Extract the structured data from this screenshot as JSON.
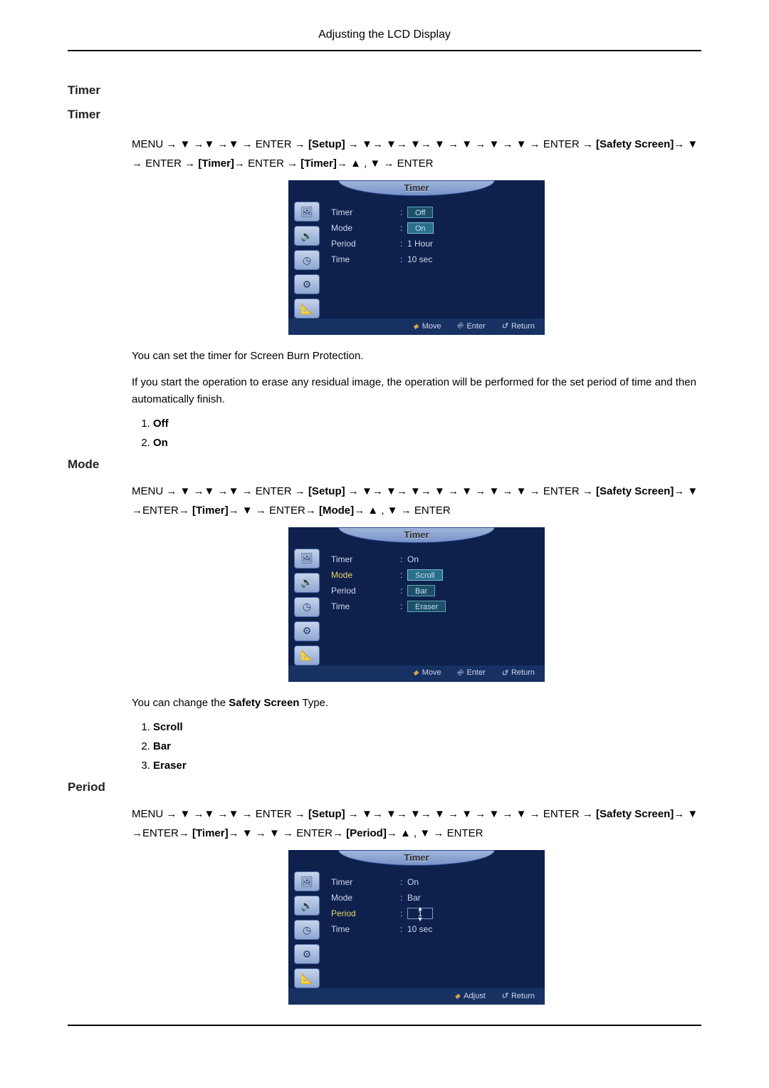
{
  "page_header": "Adjusting the LCD Display",
  "sections": {
    "timer": {
      "heading1": "Timer",
      "heading2": "Timer",
      "nav": {
        "start": "MENU → ",
        "enter1": " → ENTER → ",
        "setup": "[Setup]",
        "mid": " → ",
        "enter2": " → ENTER →",
        "safety": "[Safety Screen]",
        "safety_after": "→ ",
        "enter3": " → ENTER → ",
        "timer1": "[Timer]",
        "enter4": "→ ENTER → ",
        "timer2": "[Timer]",
        "tail": "→ ",
        "enter_final": " → ENTER"
      },
      "desc1": "You can set the timer for Screen Burn Protection.",
      "desc2": "If you start the operation to erase any residual image, the operation will be performed for the set period of time and then automatically finish.",
      "options": [
        "Off",
        "On"
      ],
      "osd": {
        "title": "Timer",
        "rows": [
          {
            "label": "Timer",
            "value_off": "Off",
            "value_on": "On"
          },
          {
            "label": "Mode",
            "value": ""
          },
          {
            "label": "Period",
            "value": "1 Hour"
          },
          {
            "label": "Time",
            "value": "10 sec"
          }
        ],
        "footer": {
          "move": "Move",
          "enter": "Enter",
          "return": "Return"
        }
      }
    },
    "mode": {
      "heading": "Mode",
      "nav": {
        "start": "MENU → ",
        "enter1": " → ENTER → ",
        "setup": "[Setup]",
        "mid": " → ",
        "enter2": " → ENTER →",
        "safety": "[Safety Screen]",
        "safety_after": "→ ",
        "enter3": " →ENTER→ ",
        "timer1": "[Timer]",
        "mid2": "→ ",
        "enter4": " → ENTER→ ",
        "mode": "[Mode]",
        "tail": "→ ",
        "enter_final": " → ENTER"
      },
      "desc_pre": "You can change the ",
      "desc_bold": "Safety Screen",
      "desc_post": " Type.",
      "options": [
        "Scroll",
        "Bar",
        "Eraser"
      ],
      "osd": {
        "title": "Timer",
        "rows": [
          {
            "label": "Timer",
            "value": "On"
          },
          {
            "label": "Mode",
            "opts": [
              "Scroll",
              "Bar",
              "Eraser"
            ]
          },
          {
            "label": "Period",
            "value": ""
          },
          {
            "label": "Time",
            "value": ""
          }
        ],
        "footer": {
          "move": "Move",
          "enter": "Enter",
          "return": "Return"
        }
      }
    },
    "period": {
      "heading": "Period",
      "nav": {
        "start": "MENU → ",
        "enter1": " → ENTER → ",
        "setup": "[Setup]",
        "mid": " → ",
        "enter2": " → ENTER →",
        "safety": "[Safety Screen]",
        "safety_after": "→ ",
        "enter3": " →ENTER→ ",
        "timer1": "[Timer]",
        "mid2": "→ ",
        "mid3": " → ",
        "enter4": " → ENTER→ ",
        "periodlbl": "[Period]",
        "tail": "→ ",
        "enter_final": " → ENTER"
      },
      "osd": {
        "title": "Timer",
        "rows": [
          {
            "label": "Timer",
            "value": "On"
          },
          {
            "label": "Mode",
            "value": "Bar"
          },
          {
            "label": "Period",
            "numvalue": "1"
          },
          {
            "label": "Time",
            "value": "10 sec"
          }
        ],
        "footer": {
          "adjust": "Adjust",
          "return": "Return"
        }
      }
    }
  },
  "glyphs": {
    "down": "▼",
    "up": "▲",
    "comma": " , "
  }
}
